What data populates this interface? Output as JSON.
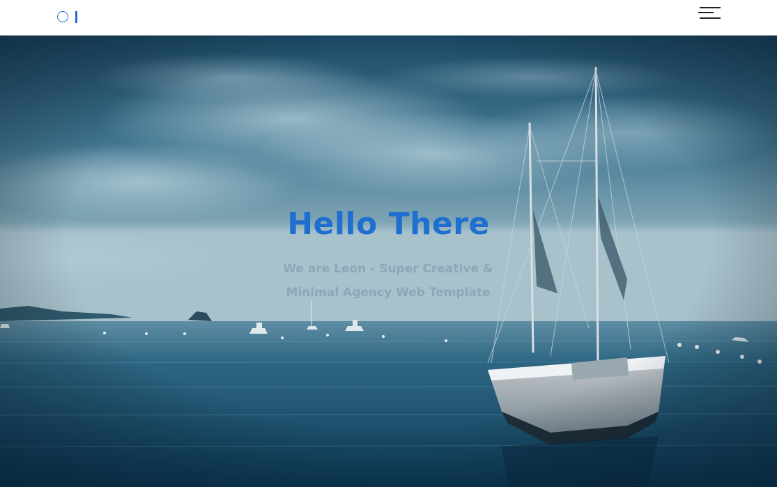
{
  "header": {
    "logo_icon": "circle-logo-icon",
    "menu_icon": "hamburger-menu-icon",
    "accent_color": "#1f6fd1"
  },
  "hero": {
    "title": "Hello There",
    "subtitle_line1": "We are Leon - Super Creative &",
    "subtitle_line2": "Minimal Agency Web Template",
    "title_color": "#1f6fd1",
    "subtitle_color": "#8ea6b8"
  }
}
